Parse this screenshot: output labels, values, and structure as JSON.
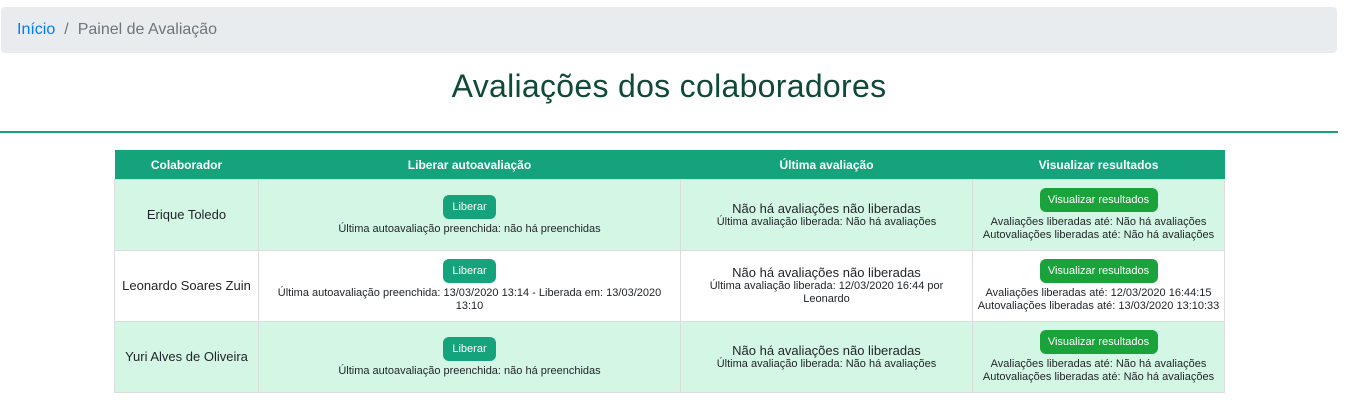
{
  "breadcrumb": {
    "home": "Início",
    "separator": "/",
    "current": "Painel de Avaliação"
  },
  "page_title": "Avaliações dos colaboradores",
  "table": {
    "headers": [
      "Colaborador",
      "Liberar autoavaliação",
      "Última avaliação",
      "Visualizar resultados"
    ],
    "rows": [
      {
        "name": "Erique Toledo",
        "liberar_label": "Liberar",
        "autoavaliacao_info": "Última autoavaliação preenchida: não há preenchidas",
        "ultima_main": "Não há avaliações não liberadas",
        "ultima_sub": "Última avaliação liberada: Não há avaliações",
        "visualizar_label": "Visualizar resultados",
        "resultados_line1": "Avaliações liberadas até: Não há avaliações",
        "resultados_line2": "Autovaliações liberadas até: Não há avaliações"
      },
      {
        "name": "Leonardo Soares Zuin",
        "liberar_label": "Liberar",
        "autoavaliacao_info": "Última autoavaliação preenchida: 13/03/2020 13:14 - Liberada em: 13/03/2020 13:10",
        "ultima_main": "Não há avaliações não liberadas",
        "ultima_sub": "Última avaliação liberada: 12/03/2020 16:44 por Leonardo",
        "visualizar_label": "Visualizar resultados",
        "resultados_line1": "Avaliações liberadas até: 12/03/2020 16:44:15",
        "resultados_line2": "Autovaliações liberadas até: 13/03/2020 13:10:33"
      },
      {
        "name": "Yuri Alves de Oliveira",
        "liberar_label": "Liberar",
        "autoavaliacao_info": "Última autoavaliação preenchida: não há preenchidas",
        "ultima_main": "Não há avaliações não liberadas",
        "ultima_sub": "Última avaliação liberada: Não há avaliações",
        "visualizar_label": "Visualizar resultados",
        "resultados_line1": "Avaliações liberadas até: Não há avaliações",
        "resultados_line2": "Autovaliações liberadas até: Não há avaliações"
      }
    ]
  },
  "colors": {
    "header_green": "#14a37a",
    "row_green": "#d4f7e5",
    "button_green": "#1aa33a",
    "link_blue": "#007bff"
  }
}
